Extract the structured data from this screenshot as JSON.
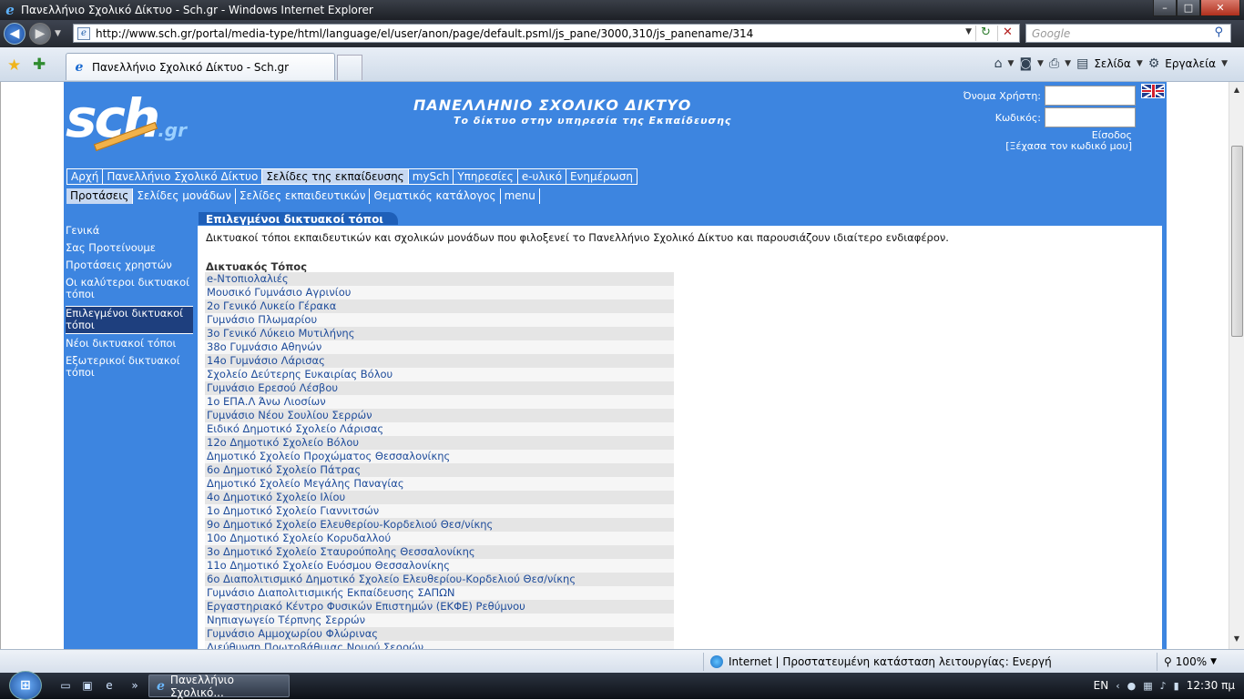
{
  "window": {
    "title": "Πανελλήνιο Σχολικό Δίκτυο - Sch.gr - Windows Internet Explorer",
    "min": "–",
    "max": "□",
    "close": "✕"
  },
  "address": {
    "url": "http://www.sch.gr/portal/media-type/html/language/el/user/anon/page/default.psml/js_pane/3000,310/js_panename/314",
    "search_placeholder": "Google"
  },
  "tabs": {
    "active_label": "Πανελλήνιο Σχολικό Δίκτυο - Sch.gr"
  },
  "commandbar": {
    "page_label": "Σελίδα",
    "tools_label": "Εργαλεία"
  },
  "site": {
    "title": "ΠΑΝΕΛΛΗΝΙΟ ΣΧΟΛΙΚΟ ΔΙΚΤΥΟ",
    "subtitle": "Το δίκτυο στην υπηρεσία της Εκπαίδευσης",
    "logo": "sch",
    "logo_suffix": ".gr",
    "login": {
      "username_label": "Όνομα Χρήστη:",
      "password_label": "Κωδικός:",
      "enter_label": "Είσοδος",
      "forgot_label": "[Ξέχασα τον κωδικό μου]"
    }
  },
  "menu_main": [
    {
      "label": "Αρχή",
      "active": false
    },
    {
      "label": "Πανελλήνιο Σχολικό Δίκτυο",
      "active": false
    },
    {
      "label": "Σελίδες της εκπαίδευσης",
      "active": true
    },
    {
      "label": "mySch",
      "active": false
    },
    {
      "label": "Υπηρεσίες",
      "active": false
    },
    {
      "label": "e-υλικό",
      "active": false
    },
    {
      "label": "Ενημέρωση",
      "active": false
    }
  ],
  "menu_sub": [
    {
      "label": "Προτάσεις",
      "active": true
    },
    {
      "label": "Σελίδες μονάδων",
      "active": false
    },
    {
      "label": "Σελίδες εκπαιδευτικών",
      "active": false
    },
    {
      "label": "Θεματικός κατάλογος",
      "active": false
    },
    {
      "label": "menu",
      "active": false
    }
  ],
  "sidebar": [
    {
      "label": "Γενικά",
      "active": false
    },
    {
      "label": "Σας Προτείνουμε",
      "active": false
    },
    {
      "label": "Προτάσεις χρηστών",
      "active": false
    },
    {
      "label": "Οι καλύτεροι δικτυακοί τόποι",
      "active": false
    },
    {
      "label": "Επιλεγμένοι δικτυακοί τόποι",
      "active": true
    },
    {
      "label": "Νέοι δικτυακοί τόποι",
      "active": false
    },
    {
      "label": "Εξωτερικοί δικτυακοί τόποι",
      "active": false
    }
  ],
  "content": {
    "tab_label": "Επιλεγμένοι δικτυακοί τόποι",
    "intro": "Δικτυακοί τόποι εκπαιδευτικών και σχολικών μονάδων που φιλοξενεί το Πανελλήνιο Σχολικό Δίκτυο και παρουσιάζουν ιδιαίτερο ενδιαφέρον.",
    "column_header": "Δικτυακός Τόπος",
    "sites": [
      "e-Ντοπιολαλιές",
      "Μουσικό Γυμνάσιο Αγρινίου",
      "2ο Γενικό Λυκείο Γέρακα",
      "Γυμνάσιο Πλωμαρίου",
      "3ο Γενικό Λύκειο Μυτιλήνης",
      "38ο Γυμνάσιο Αθηνών",
      "14ο Γυμνάσιο Λάρισας",
      "Σχολείο Δεύτερης Ευκαιρίας Βόλου",
      "Γυμνάσιο Ερεσού Λέσβου",
      "1ο ΕΠΑ.Λ Άνω Λιοσίων",
      "Γυμνάσιο Νέου Σουλίου Σερρών",
      "Ειδικό Δημοτικό Σχολείο Λάρισας",
      "12ο Δημοτικό Σχολείο Βόλου",
      "Δημοτικό Σχολείο Προχώματος Θεσσαλονίκης",
      "6ο Δημοτικό Σχολείο Πάτρας",
      "Δημοτικό Σχολείο Μεγάλης Παναγίας",
      "4ο Δημοτικό Σχολείο Ιλίου",
      "1ο Δημοτικό Σχολείο Γιαννιτσών",
      "9ο Δημοτικό Σχολείο Ελευθερίου-Κορδελιού Θεσ/νίκης",
      "10ο Δημοτικό Σχολείο Κορυδαλλού",
      "3ο Δημοτικό Σχολείο Σταυρούπολης Θεσσαλονίκης",
      "11ο Δημοτικό Σχολείο Ευόσμου Θεσσαλονίκης",
      "6ο Διαπολιτισμικό Δημοτικό Σχολείο Ελευθερίου-Κορδελιού Θεσ/νίκης",
      "Γυμνάσιο Διαπολιτισμικής Εκπαίδευσης ΣΑΠΩΝ",
      "Εργαστηριακό Κέντρο Φυσικών Επιστημών (ΕΚΦΕ) Ρεθύμνου",
      "Νηπιαγωγείο Τέρπνης Σερρών",
      "Γυμνάσιο Αμμοχωρίου Φλώρινας",
      "Διεύθυνση Πρωτοβάθμιας Νομού Σερρών"
    ]
  },
  "statusbar": {
    "zone": "Internet | Προστατευμένη κατάσταση λειτουργίας: Ενεργή",
    "zoom": "100%"
  },
  "taskbar": {
    "task_label": "Πανελλήνιο Σχολικό...",
    "lang": "EN",
    "clock": "12:30 πμ"
  }
}
